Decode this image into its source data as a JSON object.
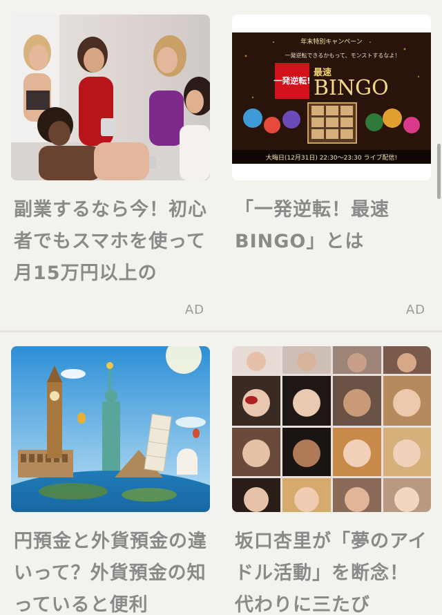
{
  "ad_label": "AD",
  "cards": [
    {
      "title": "副業するなら今！初心者でもスマホを使って月15万円以上の",
      "ad": true,
      "thumb_subject": "group-of-women-with-phones"
    },
    {
      "title": "「一発逆転！最速BINGO」とは",
      "ad": true,
      "thumb_subject": "bingo-campaign-banner",
      "banner": {
        "top_text": "年末特別キャンペーン",
        "sub_text": "一発逆転できるかもって、モンストするなよ！",
        "badge_text": "一発逆転!",
        "headline_small": "最速",
        "headline_big": "BINGO",
        "footer_text": "大晦日(12月31日) 22:30～23:30 ライブ配信!"
      }
    },
    {
      "title": "円預金と外貨預金の違いって？外貨預金の知っていると便利",
      "ad": false,
      "thumb_subject": "world-landmarks-collage"
    },
    {
      "title": "坂口杏里が「夢のアイドル活動」を断念！ 代わりに三たび",
      "ad": false,
      "thumb_subject": "face-grid-collage"
    }
  ],
  "colors": {
    "background": "#f3f2ed",
    "title_text": "#8a8a8a",
    "ad_text": "#9a9a9a"
  }
}
